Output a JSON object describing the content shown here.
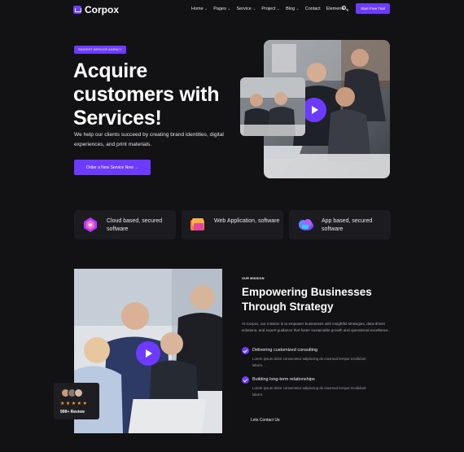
{
  "header": {
    "brand": "Corpox",
    "menu": [
      "Home",
      "Pages",
      "Service",
      "Project",
      "Blog",
      "Contact",
      "Elements"
    ],
    "menu_dropdowns": [
      true,
      true,
      true,
      true,
      true,
      false,
      true
    ],
    "cta_label": "Start Free Trial"
  },
  "hero": {
    "badge": "BIGGEST SERVICE AGENCY",
    "title": "Acquire customers with Services!",
    "description": "We help our clients succeed by creating brand identities, digital experiences, and print materials.",
    "cta_label": "Order a New Service Now →"
  },
  "features": [
    {
      "label": "Cloud based, secured software",
      "icon": "cloud-lock-icon"
    },
    {
      "label": "Web Application, software",
      "icon": "web-app-icon"
    },
    {
      "label": "App based, secured software",
      "icon": "cloud-app-icon"
    }
  ],
  "mission": {
    "eyebrow": "OUR MISSION",
    "title": "Empowering Businesses Through Strategy",
    "description": "At Corpox, our mission is to empower businesses with insightful strategies, data-driven solutions, and expert guidance that foster sustainable growth and operational excellence.",
    "items": [
      {
        "title": "Delivering customized consulting",
        "desc": "Lorem ipsum dolor consectetur adipiscing do eiusmod tempor incididunt labore."
      },
      {
        "title": "Building long-term relationships",
        "desc": "Lorem ipsum dolor consectetur adipiscing do eiusmod tempor incididunt labore."
      }
    ],
    "contact_label": "Lets Contact Us"
  },
  "review": {
    "stars": "★★★★★",
    "text": "999+ Review"
  },
  "colors": {
    "accent": "#6c3bff",
    "background": "#121215"
  }
}
